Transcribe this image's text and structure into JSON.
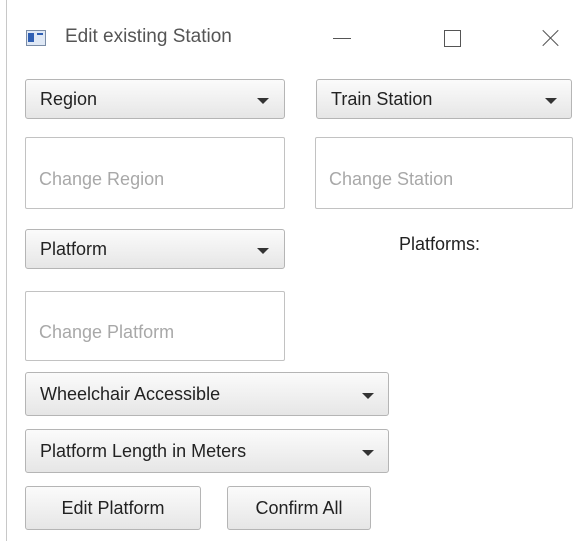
{
  "window": {
    "title": "Edit existing Station",
    "icon": "app-window-icon",
    "controls": [
      "minimize-icon",
      "maximize-icon",
      "close-icon"
    ]
  },
  "form": {
    "region_dropdown": {
      "label": "Region"
    },
    "train_station_dropdown": {
      "label": "Train Station"
    },
    "change_region_input": {
      "placeholder": "Change Region",
      "value": ""
    },
    "change_station_input": {
      "placeholder": "Change Station",
      "value": ""
    },
    "platform_dropdown": {
      "label": "Platform"
    },
    "platforms_label": "Platforms:",
    "change_platform_input": {
      "placeholder": "Change Platform",
      "value": ""
    },
    "wheelchair_dropdown": {
      "label": "Wheelchair Accessible"
    },
    "platform_length_dropdown": {
      "label": "Platform Length in Meters"
    },
    "edit_platform_button": "Edit Platform",
    "confirm_all_button": "Confirm All"
  }
}
